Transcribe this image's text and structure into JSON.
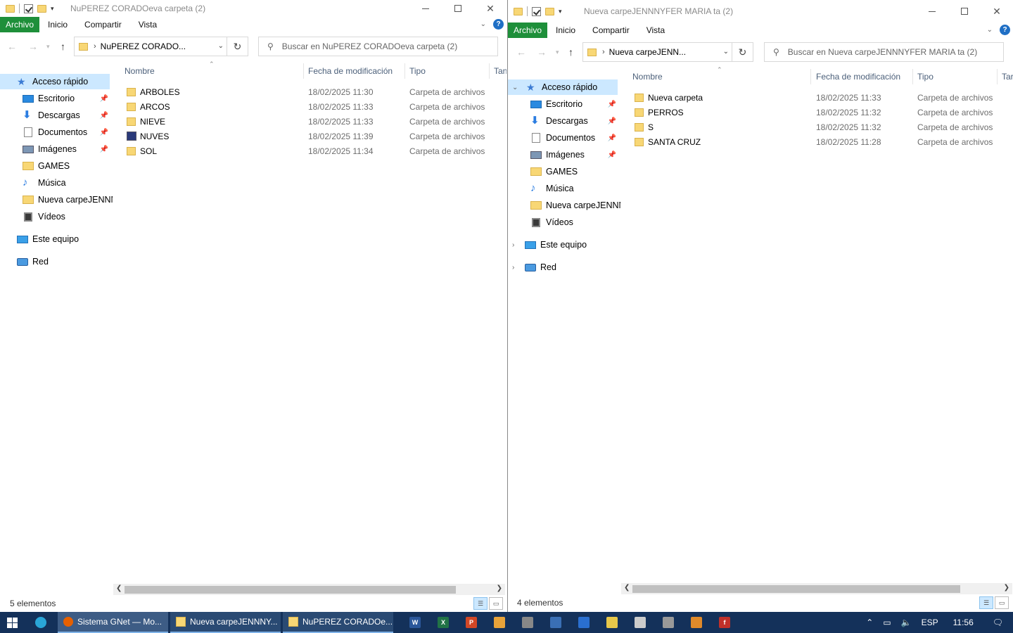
{
  "left": {
    "title": "NuPEREZ CORADOeva carpeta (2)",
    "tabs": [
      "Archivo",
      "Inicio",
      "Compartir",
      "Vista"
    ],
    "address": "NuPEREZ CORADO...",
    "search_placeholder": "Buscar en NuPEREZ CORADOeva carpeta (2)",
    "sidebar": [
      {
        "label": "Acceso rápido",
        "icon": "star-icon",
        "selected": true
      },
      {
        "label": "Escritorio",
        "icon": "desktop-icon",
        "pinned": true
      },
      {
        "label": "Descargas",
        "icon": "download-icon",
        "pinned": true
      },
      {
        "label": "Documentos",
        "icon": "documents-icon",
        "pinned": true
      },
      {
        "label": "Imágenes",
        "icon": "pictures-icon",
        "pinned": true
      },
      {
        "label": "GAMES",
        "icon": "folder-icon"
      },
      {
        "label": "Música",
        "icon": "music-icon"
      },
      {
        "label": "Nueva carpeJENNN",
        "icon": "folder-icon"
      },
      {
        "label": "Vídeos",
        "icon": "videos-icon"
      },
      {
        "label": "Este equipo",
        "icon": "computer-icon"
      },
      {
        "label": "Red",
        "icon": "network-icon"
      }
    ],
    "columns": [
      "Nombre",
      "Fecha de modificación",
      "Tipo",
      "Tan"
    ],
    "files": [
      {
        "name": "ARBOLES",
        "date": "18/02/2025 11:30",
        "type": "Carpeta de archivos"
      },
      {
        "name": "ARCOS",
        "date": "18/02/2025 11:33",
        "type": "Carpeta de archivos"
      },
      {
        "name": "NIEVE",
        "date": "18/02/2025 11:33",
        "type": "Carpeta de archivos"
      },
      {
        "name": "NUVES",
        "date": "18/02/2025 11:39",
        "type": "Carpeta de archivos"
      },
      {
        "name": "SOL",
        "date": "18/02/2025 11:34",
        "type": "Carpeta de archivos"
      }
    ],
    "status": "5 elementos"
  },
  "right": {
    "title": "Nueva carpeJENNNYFER MARIA ta (2)",
    "tabs": [
      "Archivo",
      "Inicio",
      "Compartir",
      "Vista"
    ],
    "address": "Nueva carpeJENN...",
    "search_placeholder": "Buscar en Nueva carpeJENNNYFER MARIA ta (2)",
    "sidebar": [
      {
        "label": "Acceso rápido",
        "icon": "star-icon",
        "selected": true
      },
      {
        "label": "Escritorio",
        "icon": "desktop-icon",
        "pinned": true
      },
      {
        "label": "Descargas",
        "icon": "download-icon",
        "pinned": true
      },
      {
        "label": "Documentos",
        "icon": "documents-icon",
        "pinned": true
      },
      {
        "label": "Imágenes",
        "icon": "pictures-icon",
        "pinned": true
      },
      {
        "label": "GAMES",
        "icon": "folder-icon"
      },
      {
        "label": "Música",
        "icon": "music-icon"
      },
      {
        "label": "Nueva carpeJENNN",
        "icon": "folder-icon"
      },
      {
        "label": "Vídeos",
        "icon": "videos-icon"
      },
      {
        "label": "Este equipo",
        "icon": "computer-icon"
      },
      {
        "label": "Red",
        "icon": "network-icon"
      }
    ],
    "columns": [
      "Nombre",
      "Fecha de modificación",
      "Tipo",
      "Tar"
    ],
    "files": [
      {
        "name": "Nueva carpeta",
        "date": "18/02/2025 11:33",
        "type": "Carpeta de archivos"
      },
      {
        "name": "PERROS",
        "date": "18/02/2025 11:32",
        "type": "Carpeta de archivos"
      },
      {
        "name": "S",
        "date": "18/02/2025 11:32",
        "type": "Carpeta de archivos"
      },
      {
        "name": "SANTA CRUZ",
        "date": "18/02/2025 11:28",
        "type": "Carpeta de archivos"
      }
    ],
    "status": "4 elementos"
  },
  "taskbar": {
    "apps": [
      {
        "label": "Sistema GNet — Mo...",
        "icon": "firefox-icon"
      },
      {
        "label": "Nueva carpeJENNNY...",
        "icon": "folder-icon"
      },
      {
        "label": "NuPEREZ CORADOe...",
        "icon": "folder-icon"
      }
    ],
    "pinned_icons": [
      {
        "name": "word-icon",
        "letter": "W",
        "color": "#2b579a"
      },
      {
        "name": "excel-icon",
        "letter": "X",
        "color": "#217346"
      },
      {
        "name": "powerpoint-icon",
        "letter": "P",
        "color": "#d24726"
      },
      {
        "name": "paint-icon",
        "letter": "",
        "color": "#e8a33a"
      },
      {
        "name": "tool-icon",
        "letter": "",
        "color": "#888888"
      },
      {
        "name": "app-icon",
        "letter": "",
        "color": "#3a6fb5"
      },
      {
        "name": "monitor-icon",
        "letter": "",
        "color": "#2a6fd0"
      },
      {
        "name": "notes-icon",
        "letter": "",
        "color": "#e8c84a"
      },
      {
        "name": "pattern-icon",
        "letter": "",
        "color": "#cccccc"
      },
      {
        "name": "stack-icon",
        "letter": "",
        "color": "#999999"
      },
      {
        "name": "gallery-icon",
        "letter": "",
        "color": "#e08a2a"
      },
      {
        "name": "flash-icon",
        "letter": "f",
        "color": "#c0302a"
      }
    ],
    "lang": "ESP",
    "time": "11:56"
  }
}
